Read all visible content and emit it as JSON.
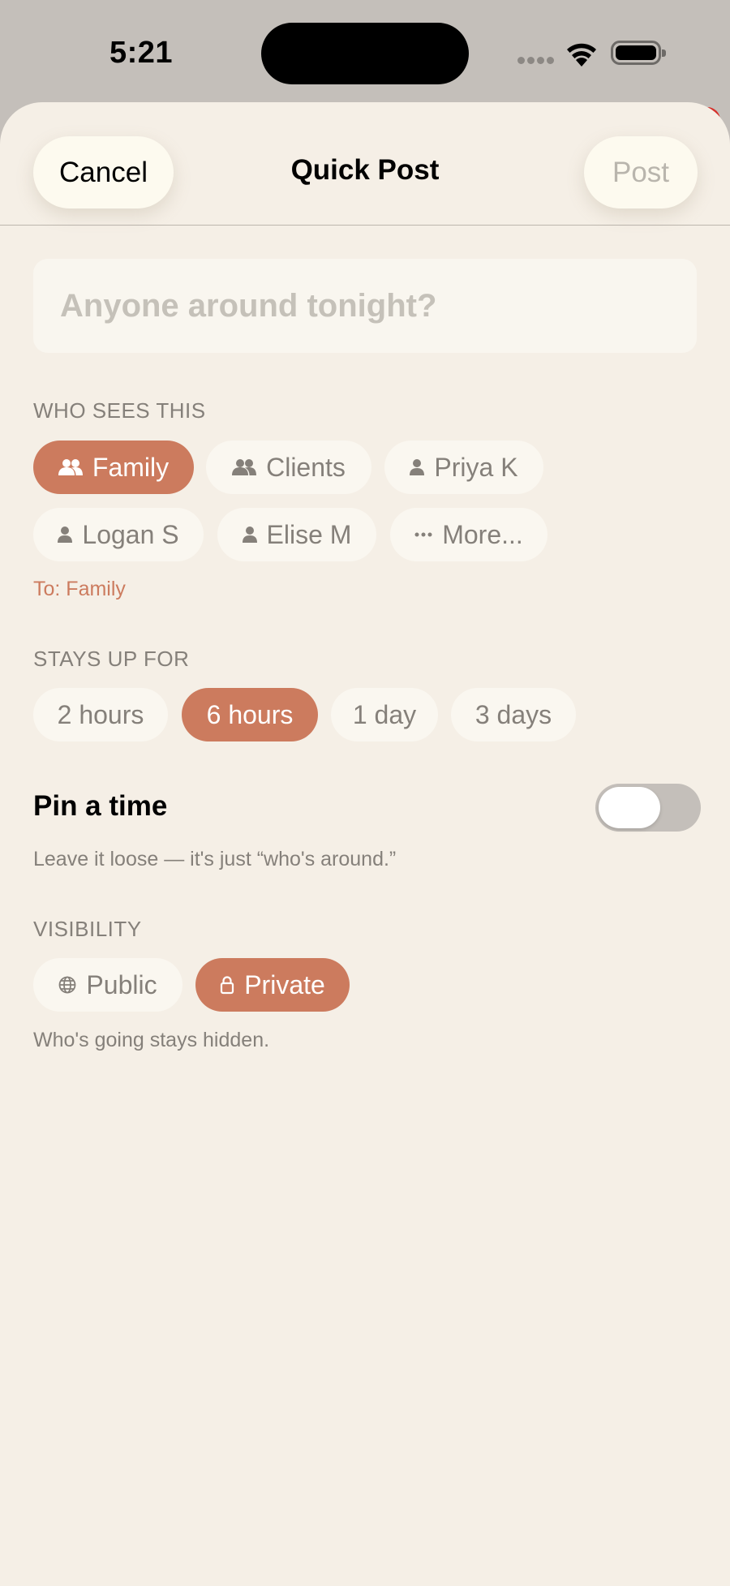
{
  "status": {
    "time": "5:21"
  },
  "header": {
    "cancel_label": "Cancel",
    "title": "Quick Post",
    "post_label": "Post"
  },
  "composer": {
    "placeholder": "Anyone around tonight?"
  },
  "audience": {
    "label": "WHO SEES THIS",
    "chips": [
      {
        "label": "Family",
        "icon": "people-icon",
        "selected": true
      },
      {
        "label": "Clients",
        "icon": "people-icon",
        "selected": false
      },
      {
        "label": "Priya K",
        "icon": "person-icon",
        "selected": false
      },
      {
        "label": "Logan S",
        "icon": "person-icon",
        "selected": false
      },
      {
        "label": "Elise M",
        "icon": "person-icon",
        "selected": false
      },
      {
        "label": "More...",
        "icon": "ellipsis-icon",
        "selected": false
      }
    ],
    "to_text": "To: Family"
  },
  "duration": {
    "label": "STAYS UP FOR",
    "options": [
      {
        "label": "2 hours",
        "selected": false
      },
      {
        "label": "6 hours",
        "selected": true
      },
      {
        "label": "1 day",
        "selected": false
      },
      {
        "label": "3 days",
        "selected": false
      }
    ]
  },
  "pin_time": {
    "title": "Pin a time",
    "enabled": false,
    "description": "Leave it loose — it's just “who's around.”"
  },
  "visibility": {
    "label": "VISIBILITY",
    "options": [
      {
        "label": "Public",
        "icon": "globe-icon",
        "selected": false
      },
      {
        "label": "Private",
        "icon": "lock-icon",
        "selected": true
      }
    ],
    "description": "Who's going stays hidden."
  },
  "colors": {
    "accent": "#cc7b5e",
    "sheet_background": "#f5efe6",
    "chip_background": "#faf7f0",
    "notification_badge": "#d6312b"
  }
}
